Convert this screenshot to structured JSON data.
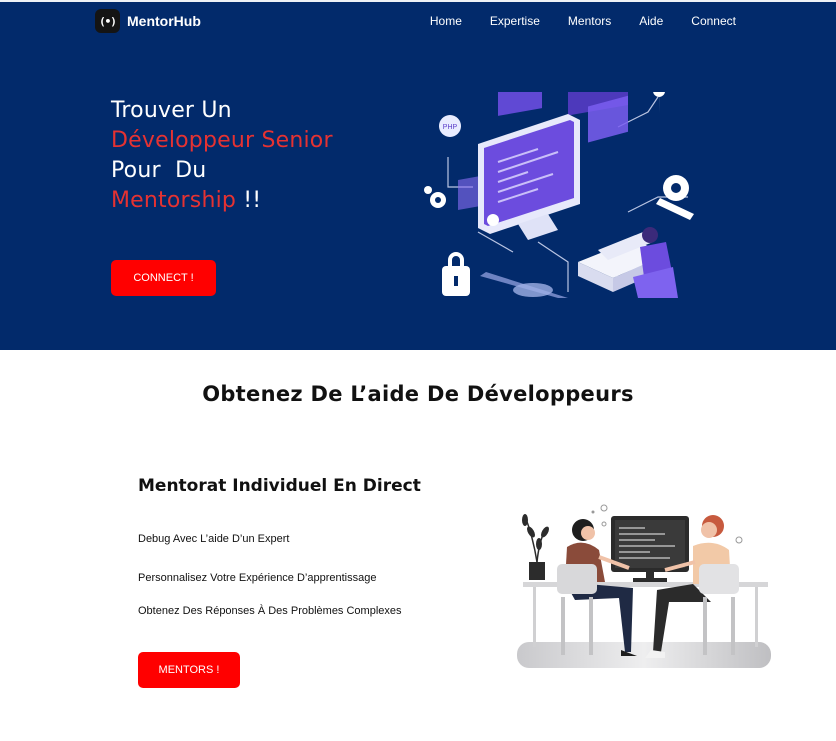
{
  "brand": {
    "name": "MentorHub",
    "mark": "(•)"
  },
  "nav": {
    "items": [
      "Home",
      "Expertise",
      "Mentors",
      "Aide",
      "Connect"
    ]
  },
  "hero": {
    "line1": "Trouver Un",
    "line2": "Développeur Senior",
    "line3": "Pour  Du",
    "line4": "Mentorship",
    "line4_suffix": " !!",
    "cta": "CONNECT !"
  },
  "section": {
    "title": "Obtenez De L’aide De Développeurs",
    "subtitle": "Mentorat Individuel En Direct",
    "features": [
      "Debug Avec L’aide D’un Expert",
      "Personnalisez Votre Expérience D’apprentissage",
      "Obtenez Des Réponses À Des Problèmes Complexes"
    ],
    "cta": "MENTORS !"
  },
  "illustrations": {
    "hero": {
      "badge_text": "PHP"
    }
  },
  "colors": {
    "hero_bg": "#022a6b",
    "accent_red": "#ff0000",
    "title_red": "#e53232"
  }
}
